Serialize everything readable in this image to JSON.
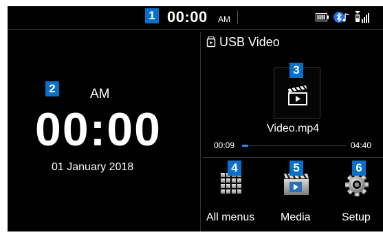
{
  "status_bar": {
    "time": "00:00",
    "ampm": "AM",
    "icons": [
      "battery-icon",
      "bluetooth-audio-icon",
      "phone-signal-icon"
    ]
  },
  "clock_widget": {
    "ampm": "AM",
    "time": "00:00",
    "date": "01 January 2018"
  },
  "media_widget": {
    "source_title": "USB Video",
    "source_icon": "usb-video-icon",
    "filename": "Video.mp4",
    "thumbnail_icon": "video-clapperboard-icon",
    "position": "00:09",
    "duration": "04:40",
    "progress_fraction": 0.03
  },
  "tiles": [
    {
      "label": "All menus",
      "icon": "grid-menu-icon"
    },
    {
      "label": "Media",
      "icon": "media-clapperboard-icon"
    },
    {
      "label": "Setup",
      "icon": "gear-icon"
    }
  ],
  "callouts": [
    "1",
    "2",
    "3",
    "4",
    "5",
    "6"
  ],
  "colors": {
    "screen_background": "#000000",
    "callout_badge": "#0a6fc8",
    "progress_accent": "#2a8ef0",
    "text": "#ffffff"
  }
}
